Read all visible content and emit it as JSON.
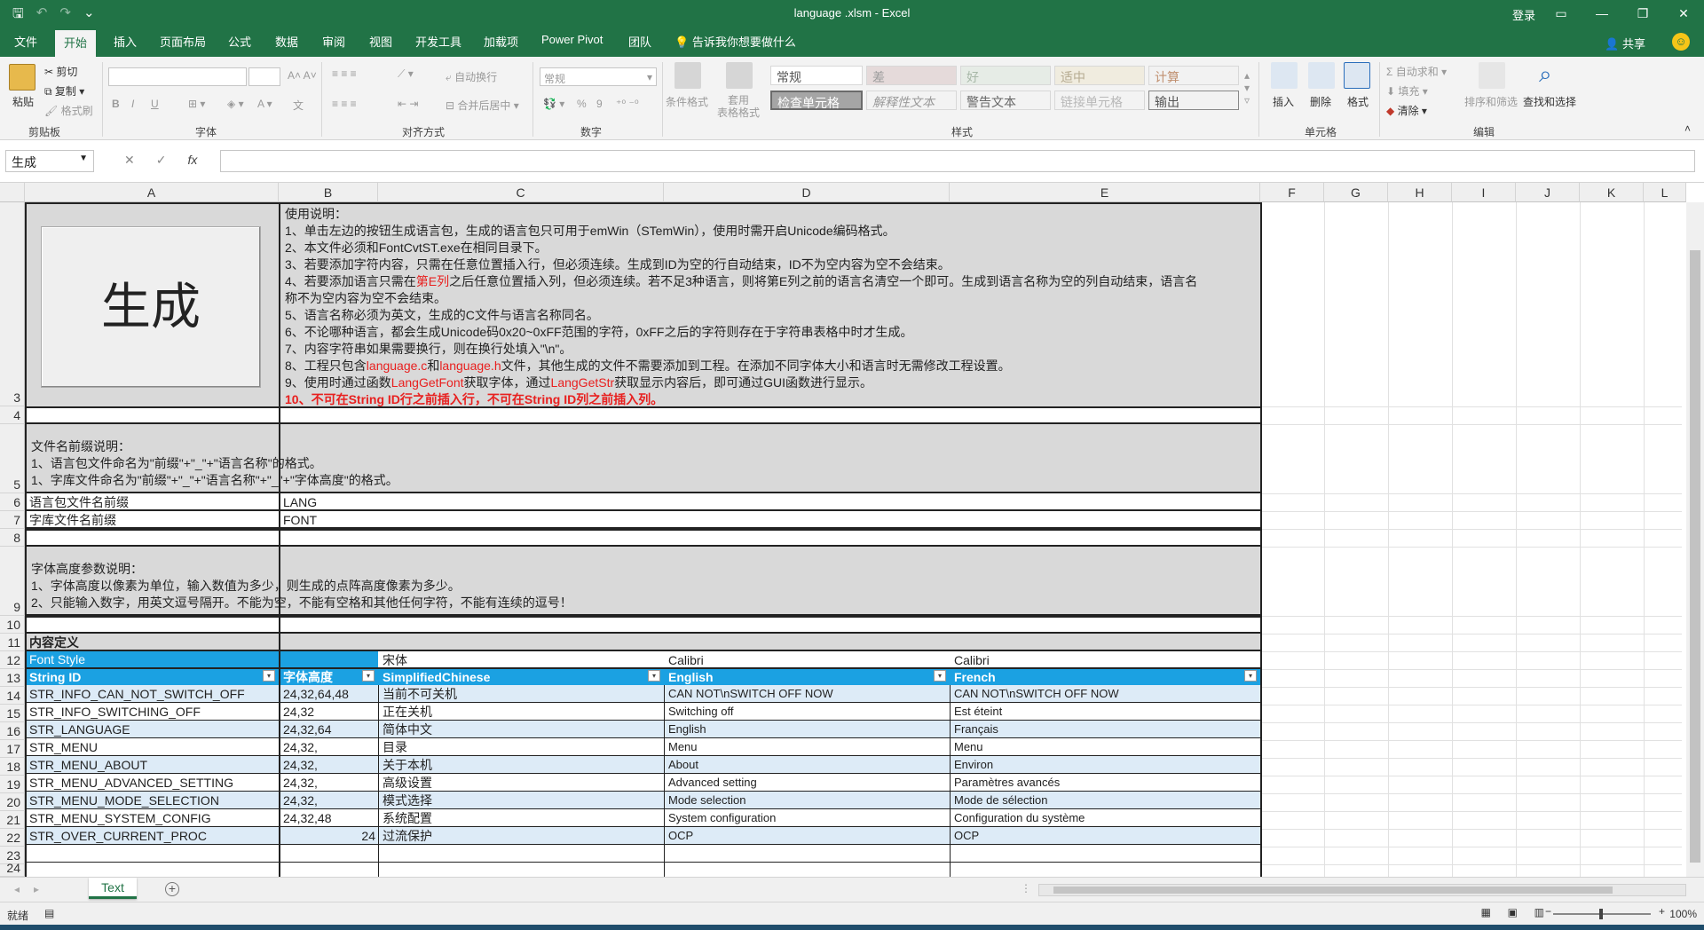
{
  "window": {
    "title": "language .xlsm  -  Excel",
    "login": "登录",
    "quick_access": [
      "save-icon",
      "undo-icon",
      "redo-icon",
      "customize-icon"
    ]
  },
  "tabs": [
    "文件",
    "开始",
    "插入",
    "页面布局",
    "公式",
    "数据",
    "审阅",
    "视图",
    "开发工具",
    "加载项",
    "Power Pivot",
    "团队"
  ],
  "active_tab": "开始",
  "tell_me": "告诉我你想要做什么",
  "share": "共享",
  "ribbon": {
    "clipboard": {
      "label": "剪贴板",
      "paste": "粘贴",
      "cut": "剪切",
      "copy": "复制",
      "painter": "格式刷"
    },
    "font": {
      "label": "字体",
      "bold": "B",
      "italic": "I",
      "underline": "U",
      "wen": "文"
    },
    "alignment": {
      "label": "对齐方式",
      "wrap": "自动换行",
      "merge": "合并后居中"
    },
    "number": {
      "label": "数字",
      "format": "常规",
      "percent": "%",
      "comma": "9"
    },
    "styles": {
      "label": "样式",
      "cond_format": "条件格式",
      "table_format": "套用\n表格格式",
      "cells": [
        "常规",
        "差",
        "好",
        "适中",
        "计算",
        "检查单元格",
        "解释性文本",
        "警告文本",
        "链接单元格",
        "输出"
      ]
    },
    "cells": {
      "label": "单元格",
      "insert": "插入",
      "delete": "删除",
      "format": "格式"
    },
    "editing": {
      "label": "编辑",
      "autosum": "自动求和",
      "fill": "填充",
      "clear": "清除",
      "sort": "排序和筛选",
      "find": "查找和选择"
    }
  },
  "formula_bar": {
    "name_box": "生成",
    "fx": "fx",
    "cancel": "✕",
    "enter": "✓",
    "content": ""
  },
  "columns": [
    "A",
    "B",
    "C",
    "D",
    "E",
    "F",
    "G",
    "H",
    "I",
    "J",
    "K",
    "L"
  ],
  "rows": [
    "3",
    "4",
    "5",
    "6",
    "7",
    "8",
    "9",
    "10",
    "11",
    "12",
    "13",
    "14",
    "15",
    "16",
    "17",
    "18",
    "19",
    "20",
    "21",
    "22",
    "23",
    "24"
  ],
  "sheet": {
    "generate_button": "生成",
    "instructions_title": "使用说明：",
    "instructions": [
      "1、单击左边的按钮生成语言包，生成的语言包只可用于emWin（STemWin），使用时需开启Unicode编码格式。",
      "2、本文件必须和FontCvtST.exe在相同目录下。",
      "3、若要添加字符内容，只需在任意位置插入行，但必须连续。生成到ID为空的行自动结束，ID不为空内容为空不会结束。",
      "4a|4、若要添加语言只需在",
      "4b|第E列",
      "4c|之后任意位置插入列，但必须连续。若不足3种语言，则将第E列之前的语言名清空一个即可。生成到语言名称为空的列自动结束，语言名",
      "称不为空内容为空不会结束。",
      "5、语言名称必须为英文，生成的C文件与语言名称同名。",
      "6、不论哪种语言，都会生成Unicode码0x20~0xFF范围的字符，0xFF之后的字符则存在于字符串表格中时才生成。",
      "7、内容字符串如果需要换行，则在换行处填入\"\\n\"。",
      "8a|8、工程只包含",
      "8b|language.c",
      "8c|和",
      "8d|language.h",
      "8e|文件，其他生成的文件不需要添加到工程。在添加不同字体大小和语言时无需修改工程设置。",
      "9a|9、使用时通过函数",
      "9b|LangGetFont",
      "9c|获取字体，通过",
      "9d|LangGetStr",
      "9e|获取显示内容后，即可通过GUI函数进行显示。",
      "10、不可在String ID行之前插入行，不可在String ID列之前插入列。"
    ],
    "prefix_title": "文件名前缀说明：",
    "prefix_lines": [
      "1、语言包文件命名为\"前缀\"+\"_\"+\"语言名称\"的格式。",
      "1、字库文件命名为\"前缀\"+\"_\"+\"语言名称\"+\"_\"+\"字体高度\"的格式。"
    ],
    "lang_prefix_label": "语言包文件名前缀",
    "lang_prefix_value": "LANG",
    "font_prefix_label": "字库文件名前缀",
    "font_prefix_value": "FONT",
    "height_title": "字体高度参数说明：",
    "height_lines": [
      "1、字体高度以像素为单位，输入数值为多少，则生成的点阵高度像素为多少。",
      "2、只能输入数字，用英文逗号隔开。不能为空，不能有空格和其他任何字符，不能有连续的逗号！"
    ],
    "content_def": "内容定义",
    "font_style_label": "Font Style",
    "font_styles": [
      "宋体",
      "Calibri",
      "Calibri"
    ],
    "headers": [
      "String ID",
      "字体高度",
      "SimplifiedChinese",
      "English",
      "French"
    ],
    "data": [
      [
        "STR_INFO_CAN_NOT_SWITCH_OFF",
        "24,32,64,48",
        "当前不可关机",
        "CAN NOT\\nSWITCH OFF NOW",
        "CAN NOT\\nSWITCH OFF NOW"
      ],
      [
        "STR_INFO_SWITCHING_OFF",
        "24,32",
        "正在关机",
        "Switching off",
        "Est éteint"
      ],
      [
        "STR_LANGUAGE",
        "24,32,64",
        "简体中文",
        "English",
        "Français"
      ],
      [
        "STR_MENU",
        "24,32,",
        "目录",
        "Menu",
        "Menu"
      ],
      [
        "STR_MENU_ABOUT",
        "24,32,",
        "关于本机",
        "About",
        "Environ"
      ],
      [
        "STR_MENU_ADVANCED_SETTING",
        "24,32,",
        "高级设置",
        "Advanced setting",
        "Paramètres avancés"
      ],
      [
        "STR_MENU_MODE_SELECTION",
        "24,32,",
        "模式选择",
        "Mode selection",
        "Mode de sélection"
      ],
      [
        "STR_MENU_SYSTEM_CONFIG",
        "24,32,48",
        "系统配置",
        "System configuration",
        "Configuration du système"
      ],
      [
        "STR_OVER_CURRENT_PROC",
        "24",
        "过流保护",
        "OCP",
        "OCP"
      ]
    ]
  },
  "sheet_tab": "Text",
  "status": {
    "ready": "就绪",
    "zoom": "100%"
  },
  "colors": {
    "excel_green": "#217346",
    "table_header": "#1ba1e2",
    "row_band": "#ddebf7",
    "note_gray": "#d9d9d9",
    "red_text": "#e8201f"
  }
}
